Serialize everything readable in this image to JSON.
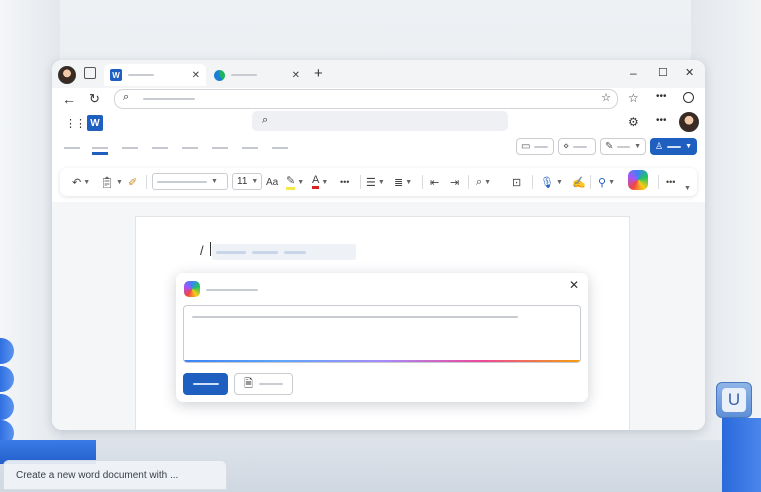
{
  "browser": {
    "tabs": [
      {
        "title": "",
        "active": true,
        "icon": "word-icon"
      },
      {
        "title": "",
        "active": false,
        "icon": "edge-icon"
      }
    ],
    "window_controls": {
      "minimize": "–",
      "maximize": "☐",
      "close": "✕"
    },
    "new_tab": "+",
    "address_placeholder": ""
  },
  "toolbar": {
    "font_size": "11",
    "font_color_letter": "A",
    "case_letters": "Aa",
    "more": "•••"
  },
  "document": {
    "slash_command": "/"
  },
  "copilot_dialog": {
    "close": "✕",
    "prompt_text": ""
  },
  "caption": {
    "text": "Create a new word document with ..."
  },
  "decor": {
    "key_letter": "U"
  },
  "colors": {
    "accent": "#1f5fbf",
    "background": "#e8ebef"
  }
}
